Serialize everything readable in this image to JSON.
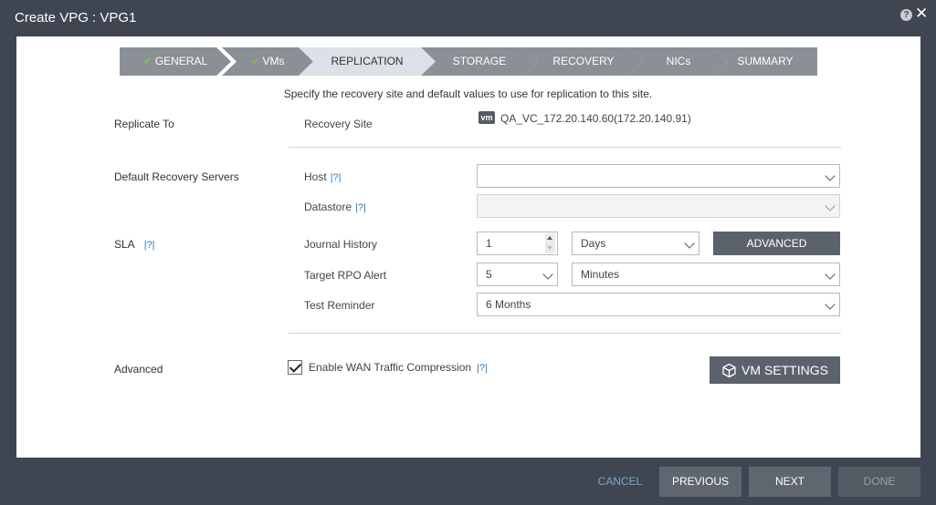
{
  "window": {
    "title": "Create VPG : VPG1"
  },
  "wizard": {
    "steps": [
      {
        "label": "GENERAL",
        "done": true
      },
      {
        "label": "VMs",
        "done": true
      },
      {
        "label": "REPLICATION",
        "active": true
      },
      {
        "label": "STORAGE"
      },
      {
        "label": "RECOVERY"
      },
      {
        "label": "NICs"
      },
      {
        "label": "SUMMARY"
      }
    ]
  },
  "instruction": "Specify the recovery site and default values to use for replication to this site.",
  "sections": {
    "replicate_to": "Replicate To",
    "default_servers": "Default Recovery Servers",
    "sla": "SLA",
    "advanced": "Advanced"
  },
  "help_marker": "|?|",
  "fields": {
    "recovery_site": {
      "label": "Recovery Site",
      "value": "QA_VC_172.20.140.60(172.20.140.91)",
      "icon_text": "vm"
    },
    "host": {
      "label": "Host",
      "value": ""
    },
    "datastore": {
      "label": "Datastore",
      "value": ""
    },
    "journal_history": {
      "label": "Journal History",
      "value": "1",
      "unit": "Days"
    },
    "target_rpo": {
      "label": "Target RPO Alert",
      "value": "5",
      "unit": "Minutes"
    },
    "test_reminder": {
      "label": "Test Reminder",
      "value": "6 Months"
    },
    "wan_compression": {
      "label": "Enable WAN Traffic Compression",
      "checked": true
    }
  },
  "buttons": {
    "advanced": "ADVANCED",
    "vm_settings": "VM SETTINGS",
    "cancel": "CANCEL",
    "previous": "PREVIOUS",
    "next": "NEXT",
    "done": "DONE"
  },
  "colors": {
    "frame": "#3f4651",
    "step_done_check": "#7dc242",
    "step_active": "#dbe1e7",
    "step_inactive": "#8b9097",
    "help_link": "#2a7ab8"
  }
}
